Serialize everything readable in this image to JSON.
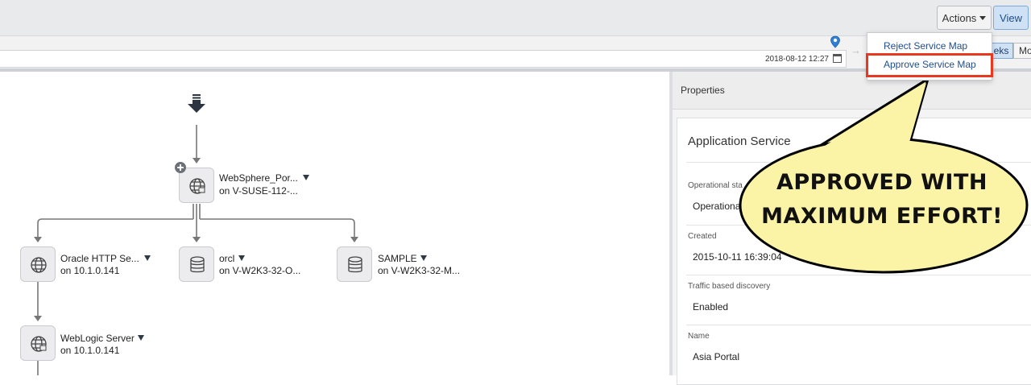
{
  "toolbar": {
    "actions_label": "Actions",
    "view_label": "View"
  },
  "timeline": {
    "timestamp": "2018-08-12 12:27",
    "weeks_label": "eks",
    "months_label": "Mo"
  },
  "actions_menu": {
    "items": [
      {
        "label": "Reject Service Map"
      },
      {
        "label": "Approve Service Map"
      }
    ]
  },
  "properties": {
    "header": "Properties",
    "card_title": "Application Service",
    "fields": [
      {
        "label": "Operational sta",
        "value": "Operationa"
      },
      {
        "label": "Created",
        "value": "2015-10-11 16:39:04"
      },
      {
        "label": "Traffic based discovery",
        "value": "Enabled"
      },
      {
        "label": "Name",
        "value": "Asia Portal"
      }
    ]
  },
  "graph": {
    "nodes": [
      {
        "title": "WebSphere_Por...",
        "sub": "on V-SUSE-112-...",
        "icon": "globe-icon"
      },
      {
        "title": "Oracle HTTP Se...",
        "sub": "on 10.1.0.141",
        "icon": "globe-icon"
      },
      {
        "title": "orcl",
        "sub": "on V-W2K3-32-O...",
        "icon": "database-icon"
      },
      {
        "title": "SAMPLE",
        "sub": "on V-W2K3-32-M...",
        "icon": "database-icon"
      },
      {
        "title": "WebLogic Server",
        "sub": "on 10.1.0.141",
        "icon": "globe-icon"
      }
    ]
  },
  "annotation": {
    "line1": "APPROVED WITH",
    "line2": "MAXIMUM EFFORT!"
  },
  "colors": {
    "highlight": "#e8381f",
    "bubble_fill": "#fbf3a6",
    "link": "#1f4e8c"
  }
}
